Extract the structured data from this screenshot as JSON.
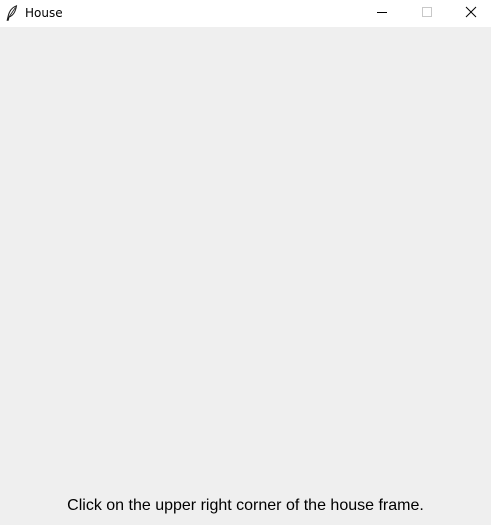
{
  "window": {
    "title": "House",
    "app_icon": "feather-icon",
    "controls": {
      "minimize_icon": "minimize-icon",
      "maximize_icon": "maximize-icon",
      "close_icon": "close-icon"
    }
  },
  "canvas": {
    "instruction": "Click on the upper right corner of the house frame."
  },
  "colors": {
    "titlebar_bg": "#ffffff",
    "window_bg": "#efefef",
    "text": "#000000"
  }
}
